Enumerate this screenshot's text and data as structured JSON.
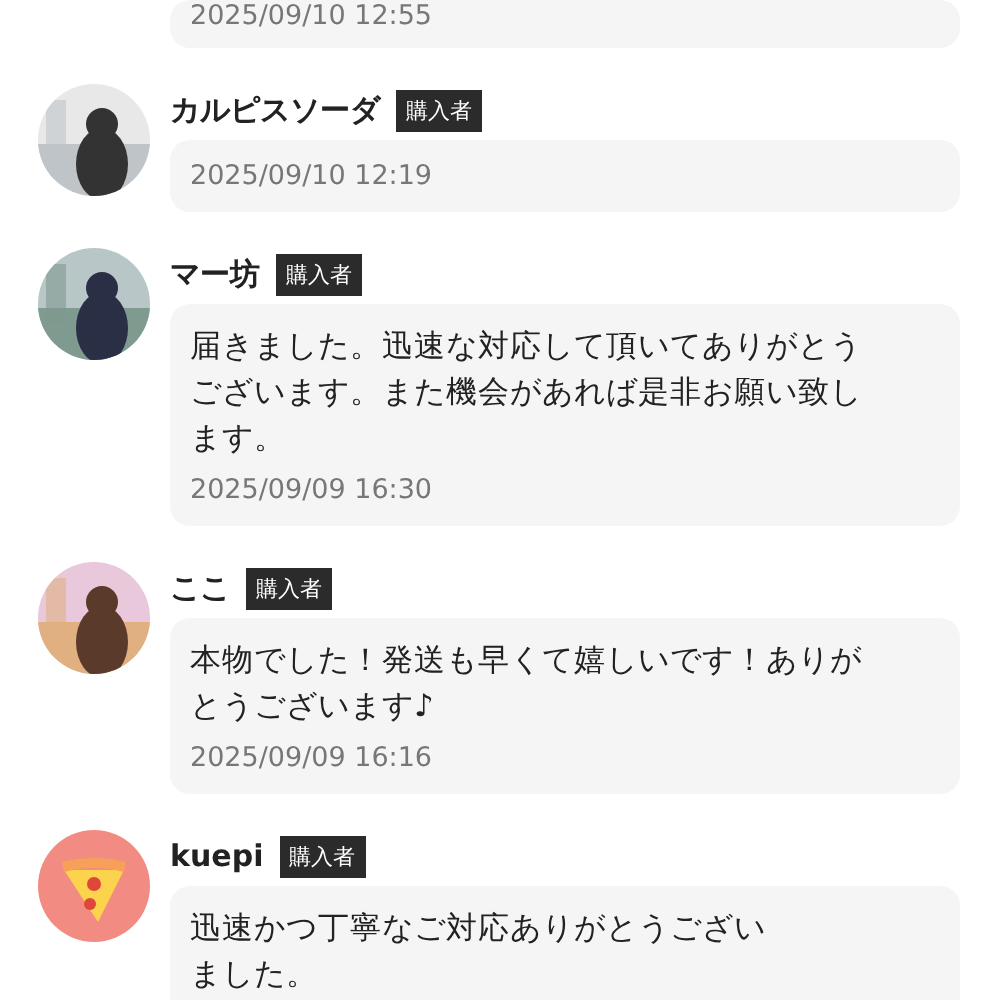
{
  "previous_review": {
    "date": "2025/09/10 12:55"
  },
  "reviews": [
    {
      "name": "カルピスソーダ",
      "badge": "購入者",
      "kind": "picture",
      "date": "2025/09/10 12:19"
    },
    {
      "name": "マー坊",
      "badge": "購入者",
      "kind": "picture",
      "lines": [
        "届きました。迅速な対応して頂いてありがとう",
        "ございます。また機会があれば是非お願い致し",
        "ます。"
      ],
      "date": "2025/09/09 16:30"
    },
    {
      "name": "ここ",
      "badge": "購入者",
      "kind": "picture",
      "lines": [
        "本物でした！発送も早くて嬉しいです！ありが",
        "とうございます♪"
      ],
      "date": "2025/09/09 16:16"
    },
    {
      "name": "kuepi",
      "badge": "購入者",
      "kind": "icon",
      "lines": [
        "迅速かつ丁寧なご対応ありがとうござい",
        "ました。"
      ]
    }
  ]
}
